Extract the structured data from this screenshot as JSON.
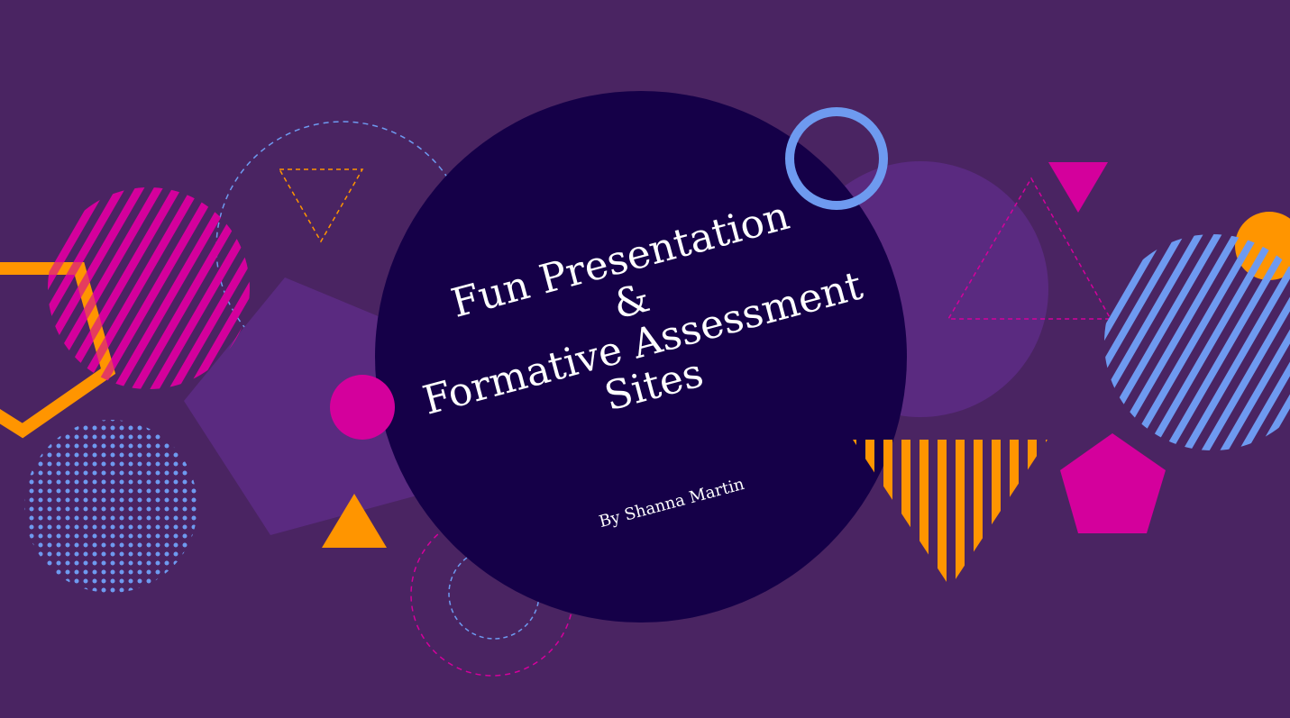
{
  "slide": {
    "title_lines": [
      "Fun Presentation",
      "&",
      "Formative Assessment",
      "Sites"
    ],
    "subtitle": "By Shanna Martin"
  },
  "colors": {
    "background": "#4a2462",
    "center_circle": "#150048",
    "accent_magenta": "#d4009c",
    "accent_orange": "#ff9500",
    "accent_blue": "#6e9af0",
    "soft_purple": "#5a2a80"
  },
  "decorations": [
    "striped-magenta-circle-icon",
    "orange-pentagon-outline-icon",
    "dotted-blue-circle-icon",
    "dashed-blue-circle-icon",
    "dashed-orange-triangle-icon",
    "purple-pentagon-icon",
    "magenta-circle-icon",
    "orange-triangle-icon",
    "dashed-circle-icon",
    "blue-ring-icon",
    "purple-circle-icon",
    "magenta-triangle-icon",
    "dashed-magenta-triangle-icon",
    "striped-blue-circle-icon",
    "orange-circle-icon",
    "striped-orange-triangle-icon",
    "magenta-pentagon-icon"
  ]
}
